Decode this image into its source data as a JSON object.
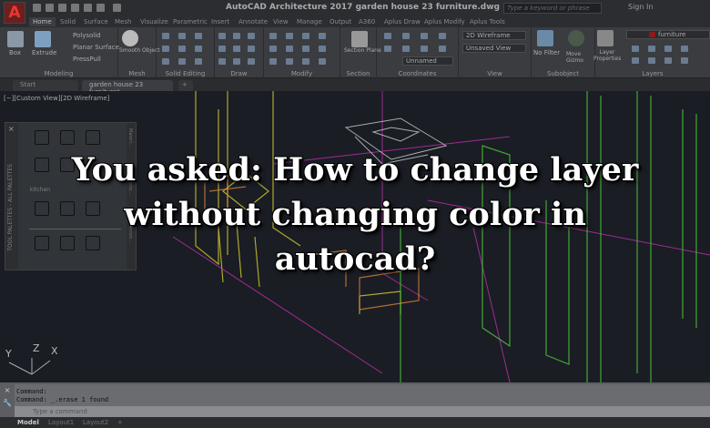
{
  "titlebar": {
    "app_icon": "A",
    "title": "AutoCAD Architecture 2017   garden house 23 furniture.dwg",
    "search_placeholder": "Type a keyword or phrase",
    "sign_in": "Sign In"
  },
  "menu_tabs": [
    "Home",
    "Solid",
    "Surface",
    "Mesh",
    "Visualize",
    "Parametric",
    "Insert",
    "Annotate",
    "View",
    "Manage",
    "Output",
    "A360",
    "Aplus Draw",
    "Aplus Modify",
    "Aplus Tools"
  ],
  "ribbon": {
    "modeling": {
      "label": "Modeling",
      "box": "Box",
      "extrude": "Extrude",
      "polysolid": "Polysolid",
      "planar_surface": "Planar Surface",
      "presspull": "PressPull"
    },
    "mesh": {
      "label": "Mesh",
      "smooth_object": "Smooth Object"
    },
    "solid_editing": {
      "label": "Solid Editing"
    },
    "draw": {
      "label": "Draw"
    },
    "modify": {
      "label": "Modify"
    },
    "section": {
      "label": "Section",
      "section_plane": "Section Plane"
    },
    "coordinates": {
      "label": "Coordinates",
      "ucs": "Unnamed"
    },
    "view": {
      "label": "View",
      "visual_style": "2D Wireframe",
      "named_view": "Unsaved View"
    },
    "subobject": {
      "label": "Subobject",
      "no_filter": "No Filter",
      "move_gizmo": "Move Gizmo"
    },
    "layers": {
      "label": "Layers",
      "layer_properties": "Layer Properties",
      "current_layer": "furniture",
      "layer_color": "#8b1a1a"
    }
  },
  "doc_tabs": [
    "Start",
    "garden house 23 furniture*"
  ],
  "viewport": {
    "label": "[−][Custom View][2D Wireframe]",
    "ucs_axes": [
      "Y",
      "Z",
      "X"
    ]
  },
  "palette": {
    "title": "TOOL PALETTES - ALL PALETTES",
    "section": "kitchen",
    "tabs": [
      "Materi...",
      "Interio...",
      "Annot..."
    ]
  },
  "overlay_title": [
    "You asked: How to change layer",
    "without changing color in",
    "autocad?"
  ],
  "command": {
    "history": [
      "Command:",
      "Command: _.erase 1 found"
    ],
    "placeholder": "Type a command"
  },
  "layout_tabs": [
    "Model",
    "Layout1",
    "Layout2",
    "+"
  ]
}
